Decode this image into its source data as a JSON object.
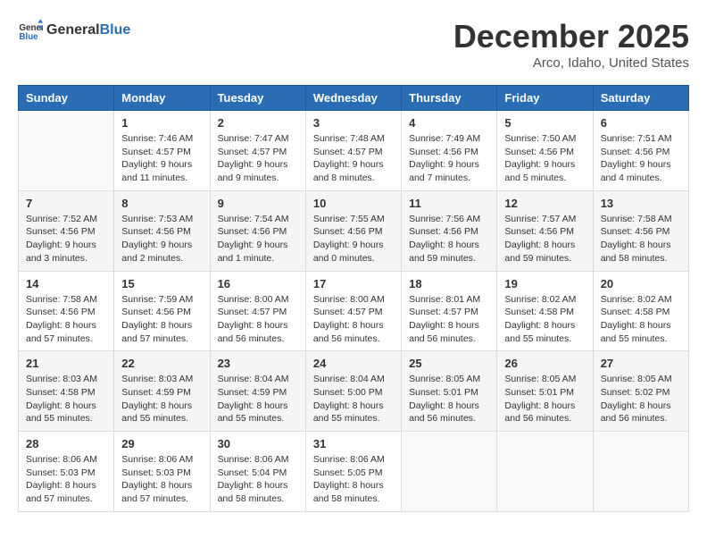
{
  "header": {
    "logo_general": "General",
    "logo_blue": "Blue",
    "title": "December 2025",
    "subtitle": "Arco, Idaho, United States"
  },
  "columns": [
    "Sunday",
    "Monday",
    "Tuesday",
    "Wednesday",
    "Thursday",
    "Friday",
    "Saturday"
  ],
  "weeks": [
    [
      {
        "day": "",
        "sunrise": "",
        "sunset": "",
        "daylight": "",
        "empty": true
      },
      {
        "day": "1",
        "sunrise": "Sunrise: 7:46 AM",
        "sunset": "Sunset: 4:57 PM",
        "daylight": "Daylight: 9 hours and 11 minutes."
      },
      {
        "day": "2",
        "sunrise": "Sunrise: 7:47 AM",
        "sunset": "Sunset: 4:57 PM",
        "daylight": "Daylight: 9 hours and 9 minutes."
      },
      {
        "day": "3",
        "sunrise": "Sunrise: 7:48 AM",
        "sunset": "Sunset: 4:57 PM",
        "daylight": "Daylight: 9 hours and 8 minutes."
      },
      {
        "day": "4",
        "sunrise": "Sunrise: 7:49 AM",
        "sunset": "Sunset: 4:56 PM",
        "daylight": "Daylight: 9 hours and 7 minutes."
      },
      {
        "day": "5",
        "sunrise": "Sunrise: 7:50 AM",
        "sunset": "Sunset: 4:56 PM",
        "daylight": "Daylight: 9 hours and 5 minutes."
      },
      {
        "day": "6",
        "sunrise": "Sunrise: 7:51 AM",
        "sunset": "Sunset: 4:56 PM",
        "daylight": "Daylight: 9 hours and 4 minutes."
      }
    ],
    [
      {
        "day": "7",
        "sunrise": "Sunrise: 7:52 AM",
        "sunset": "Sunset: 4:56 PM",
        "daylight": "Daylight: 9 hours and 3 minutes."
      },
      {
        "day": "8",
        "sunrise": "Sunrise: 7:53 AM",
        "sunset": "Sunset: 4:56 PM",
        "daylight": "Daylight: 9 hours and 2 minutes."
      },
      {
        "day": "9",
        "sunrise": "Sunrise: 7:54 AM",
        "sunset": "Sunset: 4:56 PM",
        "daylight": "Daylight: 9 hours and 1 minute."
      },
      {
        "day": "10",
        "sunrise": "Sunrise: 7:55 AM",
        "sunset": "Sunset: 4:56 PM",
        "daylight": "Daylight: 9 hours and 0 minutes."
      },
      {
        "day": "11",
        "sunrise": "Sunrise: 7:56 AM",
        "sunset": "Sunset: 4:56 PM",
        "daylight": "Daylight: 8 hours and 59 minutes."
      },
      {
        "day": "12",
        "sunrise": "Sunrise: 7:57 AM",
        "sunset": "Sunset: 4:56 PM",
        "daylight": "Daylight: 8 hours and 59 minutes."
      },
      {
        "day": "13",
        "sunrise": "Sunrise: 7:58 AM",
        "sunset": "Sunset: 4:56 PM",
        "daylight": "Daylight: 8 hours and 58 minutes."
      }
    ],
    [
      {
        "day": "14",
        "sunrise": "Sunrise: 7:58 AM",
        "sunset": "Sunset: 4:56 PM",
        "daylight": "Daylight: 8 hours and 57 minutes."
      },
      {
        "day": "15",
        "sunrise": "Sunrise: 7:59 AM",
        "sunset": "Sunset: 4:56 PM",
        "daylight": "Daylight: 8 hours and 57 minutes."
      },
      {
        "day": "16",
        "sunrise": "Sunrise: 8:00 AM",
        "sunset": "Sunset: 4:57 PM",
        "daylight": "Daylight: 8 hours and 56 minutes."
      },
      {
        "day": "17",
        "sunrise": "Sunrise: 8:00 AM",
        "sunset": "Sunset: 4:57 PM",
        "daylight": "Daylight: 8 hours and 56 minutes."
      },
      {
        "day": "18",
        "sunrise": "Sunrise: 8:01 AM",
        "sunset": "Sunset: 4:57 PM",
        "daylight": "Daylight: 8 hours and 56 minutes."
      },
      {
        "day": "19",
        "sunrise": "Sunrise: 8:02 AM",
        "sunset": "Sunset: 4:58 PM",
        "daylight": "Daylight: 8 hours and 55 minutes."
      },
      {
        "day": "20",
        "sunrise": "Sunrise: 8:02 AM",
        "sunset": "Sunset: 4:58 PM",
        "daylight": "Daylight: 8 hours and 55 minutes."
      }
    ],
    [
      {
        "day": "21",
        "sunrise": "Sunrise: 8:03 AM",
        "sunset": "Sunset: 4:58 PM",
        "daylight": "Daylight: 8 hours and 55 minutes."
      },
      {
        "day": "22",
        "sunrise": "Sunrise: 8:03 AM",
        "sunset": "Sunset: 4:59 PM",
        "daylight": "Daylight: 8 hours and 55 minutes."
      },
      {
        "day": "23",
        "sunrise": "Sunrise: 8:04 AM",
        "sunset": "Sunset: 4:59 PM",
        "daylight": "Daylight: 8 hours and 55 minutes."
      },
      {
        "day": "24",
        "sunrise": "Sunrise: 8:04 AM",
        "sunset": "Sunset: 5:00 PM",
        "daylight": "Daylight: 8 hours and 55 minutes."
      },
      {
        "day": "25",
        "sunrise": "Sunrise: 8:05 AM",
        "sunset": "Sunset: 5:01 PM",
        "daylight": "Daylight: 8 hours and 56 minutes."
      },
      {
        "day": "26",
        "sunrise": "Sunrise: 8:05 AM",
        "sunset": "Sunset: 5:01 PM",
        "daylight": "Daylight: 8 hours and 56 minutes."
      },
      {
        "day": "27",
        "sunrise": "Sunrise: 8:05 AM",
        "sunset": "Sunset: 5:02 PM",
        "daylight": "Daylight: 8 hours and 56 minutes."
      }
    ],
    [
      {
        "day": "28",
        "sunrise": "Sunrise: 8:06 AM",
        "sunset": "Sunset: 5:03 PM",
        "daylight": "Daylight: 8 hours and 57 minutes."
      },
      {
        "day": "29",
        "sunrise": "Sunrise: 8:06 AM",
        "sunset": "Sunset: 5:03 PM",
        "daylight": "Daylight: 8 hours and 57 minutes."
      },
      {
        "day": "30",
        "sunrise": "Sunrise: 8:06 AM",
        "sunset": "Sunset: 5:04 PM",
        "daylight": "Daylight: 8 hours and 58 minutes."
      },
      {
        "day": "31",
        "sunrise": "Sunrise: 8:06 AM",
        "sunset": "Sunset: 5:05 PM",
        "daylight": "Daylight: 8 hours and 58 minutes."
      },
      {
        "day": "",
        "sunrise": "",
        "sunset": "",
        "daylight": "",
        "empty": true
      },
      {
        "day": "",
        "sunrise": "",
        "sunset": "",
        "daylight": "",
        "empty": true
      },
      {
        "day": "",
        "sunrise": "",
        "sunset": "",
        "daylight": "",
        "empty": true
      }
    ]
  ]
}
